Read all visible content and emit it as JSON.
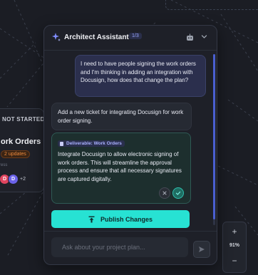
{
  "background": {
    "card": {
      "status": "NOT STARTED",
      "title": "ork Orders",
      "updates_badge": "2 updates",
      "progress_label": "ress",
      "avatars": [
        {
          "initial": "D",
          "color": "#e0455f"
        },
        {
          "initial": "D",
          "color": "#6b62e8"
        }
      ],
      "avatars_more": "+2"
    },
    "zoom": {
      "plus": "+",
      "level": "91%",
      "minus": "−"
    }
  },
  "assistant": {
    "title": "Architect Assistant",
    "page_badge": "1/3",
    "messages": {
      "user": "I need to have people signing the work orders and I'm thinking in adding an integration with Docusign, how does that change the plan?",
      "assistant": "Add a new ticket for integrating Docusign for work order signing."
    },
    "deliverable": {
      "tag": "Deliverable: Work Orders",
      "text": "Integrate Docusign to allow electronic signing of work orders. This will streamline the approval process and ensure that all necessary signatures are captured digitally."
    },
    "publish_label": "Publish Changes",
    "input_placeholder": "Ask about your project plan..."
  },
  "colors": {
    "accent_teal": "#27e2d3",
    "accent_indigo": "#4a5fd0",
    "updates_orange": "#f08a3c"
  },
  "icons": [
    "sparkle-icon",
    "robot-icon",
    "chevron-down-icon",
    "document-icon",
    "close-icon",
    "check-icon",
    "upload-icon",
    "send-icon"
  ]
}
